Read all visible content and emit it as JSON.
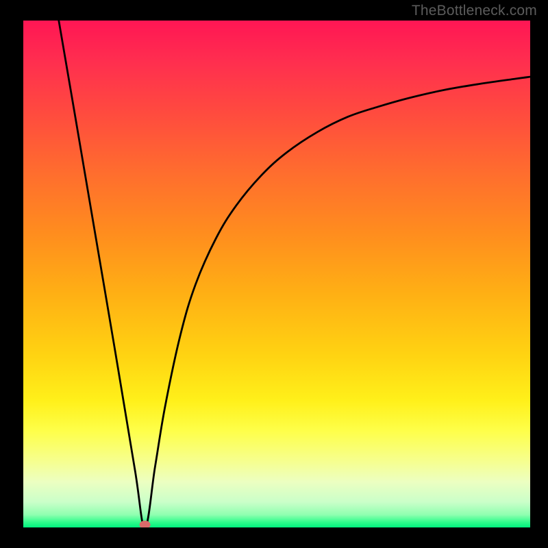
{
  "watermark": "TheBottleneck.com",
  "chart_data": {
    "type": "line",
    "title": "",
    "xlabel": "",
    "ylabel": "",
    "xlim": [
      0,
      100
    ],
    "ylim": [
      0,
      100
    ],
    "grid": false,
    "minimum_point": {
      "x": 24,
      "y": 0
    },
    "series": [
      {
        "name": "curve",
        "x": [
          7,
          10,
          14,
          18,
          22,
          24,
          26,
          28,
          31,
          34,
          38,
          42,
          47,
          52,
          58,
          64,
          70,
          76,
          83,
          90,
          97,
          100
        ],
        "y": [
          100,
          82.5,
          59,
          35.5,
          11.5,
          0,
          12,
          24,
          38,
          48,
          57,
          63.5,
          69.5,
          74,
          78,
          81,
          83,
          84.7,
          86.3,
          87.5,
          88.5,
          88.9
        ]
      }
    ],
    "gradient_stops": [
      {
        "pos": 0,
        "color": "#ff1654"
      },
      {
        "pos": 8,
        "color": "#ff2e4f"
      },
      {
        "pos": 18,
        "color": "#ff4a3f"
      },
      {
        "pos": 30,
        "color": "#ff6d2e"
      },
      {
        "pos": 42,
        "color": "#ff8d1e"
      },
      {
        "pos": 54,
        "color": "#ffb014"
      },
      {
        "pos": 66,
        "color": "#ffd312"
      },
      {
        "pos": 75,
        "color": "#fff01a"
      },
      {
        "pos": 81,
        "color": "#feff4a"
      },
      {
        "pos": 87,
        "color": "#f6ff90"
      },
      {
        "pos": 91,
        "color": "#ecffc1"
      },
      {
        "pos": 95,
        "color": "#caffc9"
      },
      {
        "pos": 97.5,
        "color": "#8fffb0"
      },
      {
        "pos": 99,
        "color": "#2dfc8a"
      },
      {
        "pos": 100,
        "color": "#00f07e"
      }
    ]
  }
}
